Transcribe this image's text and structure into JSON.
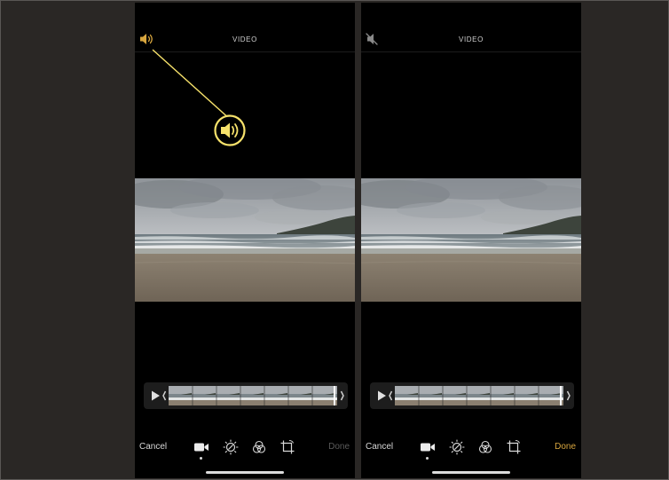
{
  "screens": [
    {
      "id": "left",
      "title": "VIDEO",
      "sound_state": "on",
      "sound_icon": "speaker-on-icon",
      "cancel_label": "Cancel",
      "done_label": "Done",
      "done_active": false,
      "tools": [
        "video-camera-icon",
        "adjust-dial-icon",
        "filters-icon",
        "crop-rotate-icon"
      ],
      "selected_tool": "video-camera-icon"
    },
    {
      "id": "right",
      "title": "VIDEO",
      "sound_state": "muted",
      "sound_icon": "speaker-muted-icon",
      "cancel_label": "Cancel",
      "done_label": "Done",
      "done_active": true,
      "tools": [
        "video-camera-icon",
        "adjust-dial-icon",
        "filters-icon",
        "crop-rotate-icon"
      ],
      "selected_tool": "video-camera-icon"
    }
  ],
  "annotation": {
    "callout_icon": "speaker-on-icon",
    "color": "#f7e26b"
  },
  "colors": {
    "accent_gold": "#d7a53e",
    "disabled_text": "#5a5a5a",
    "annotation_yellow": "#f7e26b",
    "trim_handle": "#cfcfcf"
  }
}
